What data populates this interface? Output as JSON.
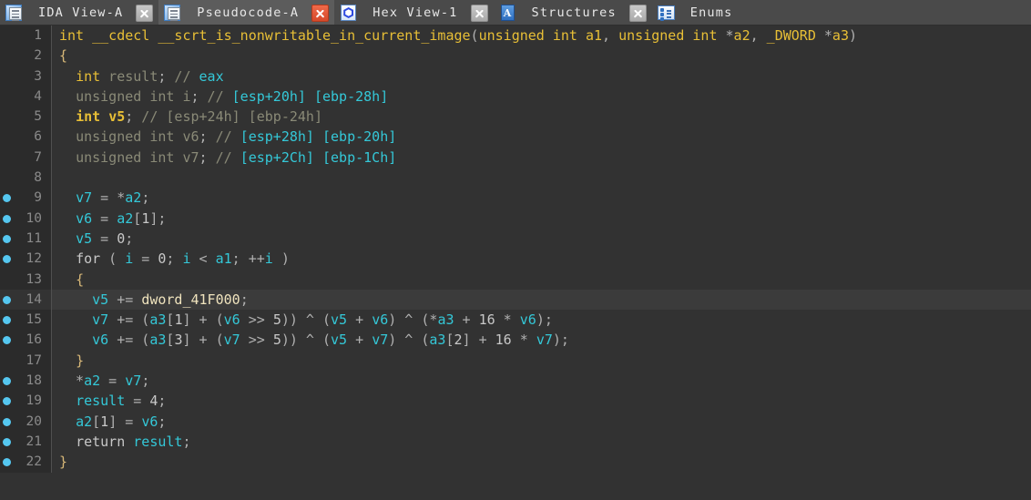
{
  "window": {
    "app": "IDA",
    "active_view": "Pseudocode-A"
  },
  "tabs": [
    {
      "label": "IDA View-A",
      "icon": "document-list-icon",
      "active": false,
      "closable": true,
      "close_style": "gray"
    },
    {
      "label": "Pseudocode-A",
      "icon": "document-list-icon",
      "active": true,
      "closable": true,
      "close_style": "red"
    },
    {
      "label": "Hex View-1",
      "icon": "hexagon-icon",
      "active": false,
      "closable": true,
      "close_style": "gray"
    },
    {
      "label": "Structures",
      "icon": "structures-a-icon",
      "active": false,
      "closable": true,
      "close_style": "gray"
    },
    {
      "label": "Enums",
      "icon": "enums-list-icon",
      "active": false,
      "closable": false,
      "close_style": "none"
    }
  ],
  "colors": {
    "tab_bar_bg": "#4a4a4a",
    "tab_active_bg": "#5c5c5c",
    "code_bg": "#323232",
    "gutter_bg": "#2b2b2b",
    "highlight_row_bg": "#3b3b3b",
    "breakpoint_dot": "#55c7f0",
    "keyword": "#e8bf36",
    "variable": "#34c8d8",
    "comment": "#8a8a77",
    "global_name": "#efe3bd",
    "line_number": "#8a8a8a",
    "punctuation": "#b0b0b0",
    "brace": "#d8b878"
  },
  "pseudocode": {
    "function_name": "__scrt_is_nonwritable_in_current_image",
    "highlighted_line": 14,
    "lines": [
      {
        "n": 1,
        "bp": false,
        "hl": false,
        "tokens": [
          {
            "t": "int",
            "c": "t-kw"
          },
          {
            "t": " ",
            "c": "t-pun"
          },
          {
            "t": "__cdecl",
            "c": "t-kw"
          },
          {
            "t": " ",
            "c": "t-pun"
          },
          {
            "t": "__scrt_is_nonwritable_in_current_image",
            "c": "t-fn"
          },
          {
            "t": "(",
            "c": "t-pun"
          },
          {
            "t": "unsigned int",
            "c": "t-kw"
          },
          {
            "t": " ",
            "c": "t-pun"
          },
          {
            "t": "a1",
            "c": "t-kw"
          },
          {
            "t": ", ",
            "c": "t-pun"
          },
          {
            "t": "unsigned int",
            "c": "t-kw"
          },
          {
            "t": " *",
            "c": "t-pun"
          },
          {
            "t": "a2",
            "c": "t-kw"
          },
          {
            "t": ", ",
            "c": "t-pun"
          },
          {
            "t": "_DWORD",
            "c": "t-kw"
          },
          {
            "t": " *",
            "c": "t-pun"
          },
          {
            "t": "a3",
            "c": "t-kw"
          },
          {
            "t": ")",
            "c": "t-pun"
          }
        ]
      },
      {
        "n": 2,
        "bp": false,
        "hl": false,
        "tokens": [
          {
            "t": "{",
            "c": "t-brc"
          }
        ]
      },
      {
        "n": 3,
        "bp": false,
        "hl": false,
        "tokens": [
          {
            "t": "  ",
            "c": "t-pun"
          },
          {
            "t": "int",
            "c": "t-kw"
          },
          {
            "t": " result",
            "c": "t-cmt"
          },
          {
            "t": ";",
            "c": "t-pun"
          },
          {
            "t": " // ",
            "c": "t-cmt"
          },
          {
            "t": "eax",
            "c": "t-cmtv"
          }
        ]
      },
      {
        "n": 4,
        "bp": false,
        "hl": false,
        "tokens": [
          {
            "t": "  ",
            "c": "t-pun"
          },
          {
            "t": "unsigned int",
            "c": "t-cmt"
          },
          {
            "t": " i",
            "c": "t-cmt"
          },
          {
            "t": ";",
            "c": "t-pun"
          },
          {
            "t": " // ",
            "c": "t-cmt"
          },
          {
            "t": "[esp+20h] [ebp-28h]",
            "c": "t-cmtv"
          }
        ]
      },
      {
        "n": 5,
        "bp": false,
        "hl": false,
        "tokens": [
          {
            "t": "  ",
            "c": "t-pun"
          },
          {
            "t": "int",
            "c": "t-hl"
          },
          {
            "t": " ",
            "c": "t-pun"
          },
          {
            "t": "v5",
            "c": "t-hl"
          },
          {
            "t": ";",
            "c": "t-pun"
          },
          {
            "t": " // ",
            "c": "t-cmt"
          },
          {
            "t": "[esp+24h] [ebp-24h]",
            "c": "t-cmt"
          }
        ]
      },
      {
        "n": 6,
        "bp": false,
        "hl": false,
        "tokens": [
          {
            "t": "  ",
            "c": "t-pun"
          },
          {
            "t": "unsigned int",
            "c": "t-cmt"
          },
          {
            "t": " v6",
            "c": "t-cmt"
          },
          {
            "t": ";",
            "c": "t-pun"
          },
          {
            "t": " // ",
            "c": "t-cmt"
          },
          {
            "t": "[esp+28h] [ebp-20h]",
            "c": "t-cmtv"
          }
        ]
      },
      {
        "n": 7,
        "bp": false,
        "hl": false,
        "tokens": [
          {
            "t": "  ",
            "c": "t-pun"
          },
          {
            "t": "unsigned int",
            "c": "t-cmt"
          },
          {
            "t": " v7",
            "c": "t-cmt"
          },
          {
            "t": ";",
            "c": "t-pun"
          },
          {
            "t": " // ",
            "c": "t-cmt"
          },
          {
            "t": "[esp+2Ch] [ebp-1Ch]",
            "c": "t-cmtv"
          }
        ]
      },
      {
        "n": 8,
        "bp": false,
        "hl": false,
        "tokens": []
      },
      {
        "n": 9,
        "bp": true,
        "hl": false,
        "tokens": [
          {
            "t": "  ",
            "c": "t-pun"
          },
          {
            "t": "v7",
            "c": "t-var"
          },
          {
            "t": " = *",
            "c": "t-pun"
          },
          {
            "t": "a2",
            "c": "t-var"
          },
          {
            "t": ";",
            "c": "t-pun"
          }
        ]
      },
      {
        "n": 10,
        "bp": true,
        "hl": false,
        "tokens": [
          {
            "t": "  ",
            "c": "t-pun"
          },
          {
            "t": "v6",
            "c": "t-var"
          },
          {
            "t": " = ",
            "c": "t-pun"
          },
          {
            "t": "a2",
            "c": "t-var"
          },
          {
            "t": "[",
            "c": "t-pun"
          },
          {
            "t": "1",
            "c": "t-num"
          },
          {
            "t": "];",
            "c": "t-pun"
          }
        ]
      },
      {
        "n": 11,
        "bp": true,
        "hl": false,
        "tokens": [
          {
            "t": "  ",
            "c": "t-pun"
          },
          {
            "t": "v5",
            "c": "t-var"
          },
          {
            "t": " = ",
            "c": "t-pun"
          },
          {
            "t": "0",
            "c": "t-num"
          },
          {
            "t": ";",
            "c": "t-pun"
          }
        ]
      },
      {
        "n": 12,
        "bp": true,
        "hl": false,
        "tokens": [
          {
            "t": "  ",
            "c": "t-pun"
          },
          {
            "t": "for",
            "c": "t-kw2"
          },
          {
            "t": " ( ",
            "c": "t-pun"
          },
          {
            "t": "i",
            "c": "t-var"
          },
          {
            "t": " = ",
            "c": "t-pun"
          },
          {
            "t": "0",
            "c": "t-num"
          },
          {
            "t": "; ",
            "c": "t-pun"
          },
          {
            "t": "i",
            "c": "t-var"
          },
          {
            "t": " < ",
            "c": "t-pun"
          },
          {
            "t": "a1",
            "c": "t-var"
          },
          {
            "t": "; ++",
            "c": "t-pun"
          },
          {
            "t": "i",
            "c": "t-var"
          },
          {
            "t": " )",
            "c": "t-pun"
          }
        ]
      },
      {
        "n": 13,
        "bp": false,
        "hl": false,
        "tokens": [
          {
            "t": "  ",
            "c": "t-pun"
          },
          {
            "t": "{",
            "c": "t-brc"
          }
        ]
      },
      {
        "n": 14,
        "bp": true,
        "hl": true,
        "tokens": [
          {
            "t": "    ",
            "c": "t-pun"
          },
          {
            "t": "v5",
            "c": "t-var"
          },
          {
            "t": " += ",
            "c": "t-pun"
          },
          {
            "t": "dword_41F000",
            "c": "t-glob"
          },
          {
            "t": ";",
            "c": "t-pun"
          }
        ]
      },
      {
        "n": 15,
        "bp": true,
        "hl": false,
        "tokens": [
          {
            "t": "    ",
            "c": "t-pun"
          },
          {
            "t": "v7",
            "c": "t-var"
          },
          {
            "t": " += (",
            "c": "t-pun"
          },
          {
            "t": "a3",
            "c": "t-var"
          },
          {
            "t": "[",
            "c": "t-pun"
          },
          {
            "t": "1",
            "c": "t-num"
          },
          {
            "t": "] + (",
            "c": "t-pun"
          },
          {
            "t": "v6",
            "c": "t-var"
          },
          {
            "t": " >> ",
            "c": "t-pun"
          },
          {
            "t": "5",
            "c": "t-num"
          },
          {
            "t": ")) ^ (",
            "c": "t-pun"
          },
          {
            "t": "v5",
            "c": "t-var"
          },
          {
            "t": " + ",
            "c": "t-pun"
          },
          {
            "t": "v6",
            "c": "t-var"
          },
          {
            "t": ") ^ (*",
            "c": "t-pun"
          },
          {
            "t": "a3",
            "c": "t-var"
          },
          {
            "t": " + ",
            "c": "t-pun"
          },
          {
            "t": "16",
            "c": "t-num"
          },
          {
            "t": " * ",
            "c": "t-pun"
          },
          {
            "t": "v6",
            "c": "t-var"
          },
          {
            "t": ");",
            "c": "t-pun"
          }
        ]
      },
      {
        "n": 16,
        "bp": true,
        "hl": false,
        "tokens": [
          {
            "t": "    ",
            "c": "t-pun"
          },
          {
            "t": "v6",
            "c": "t-var"
          },
          {
            "t": " += (",
            "c": "t-pun"
          },
          {
            "t": "a3",
            "c": "t-var"
          },
          {
            "t": "[",
            "c": "t-pun"
          },
          {
            "t": "3",
            "c": "t-num"
          },
          {
            "t": "] + (",
            "c": "t-pun"
          },
          {
            "t": "v7",
            "c": "t-var"
          },
          {
            "t": " >> ",
            "c": "t-pun"
          },
          {
            "t": "5",
            "c": "t-num"
          },
          {
            "t": ")) ^ (",
            "c": "t-pun"
          },
          {
            "t": "v5",
            "c": "t-var"
          },
          {
            "t": " + ",
            "c": "t-pun"
          },
          {
            "t": "v7",
            "c": "t-var"
          },
          {
            "t": ") ^ (",
            "c": "t-pun"
          },
          {
            "t": "a3",
            "c": "t-var"
          },
          {
            "t": "[",
            "c": "t-pun"
          },
          {
            "t": "2",
            "c": "t-num"
          },
          {
            "t": "] + ",
            "c": "t-pun"
          },
          {
            "t": "16",
            "c": "t-num"
          },
          {
            "t": " * ",
            "c": "t-pun"
          },
          {
            "t": "v7",
            "c": "t-var"
          },
          {
            "t": ");",
            "c": "t-pun"
          }
        ]
      },
      {
        "n": 17,
        "bp": false,
        "hl": false,
        "tokens": [
          {
            "t": "  ",
            "c": "t-pun"
          },
          {
            "t": "}",
            "c": "t-brc"
          }
        ]
      },
      {
        "n": 18,
        "bp": true,
        "hl": false,
        "tokens": [
          {
            "t": "  *",
            "c": "t-pun"
          },
          {
            "t": "a2",
            "c": "t-var"
          },
          {
            "t": " = ",
            "c": "t-pun"
          },
          {
            "t": "v7",
            "c": "t-var"
          },
          {
            "t": ";",
            "c": "t-pun"
          }
        ]
      },
      {
        "n": 19,
        "bp": true,
        "hl": false,
        "tokens": [
          {
            "t": "  ",
            "c": "t-pun"
          },
          {
            "t": "result",
            "c": "t-var"
          },
          {
            "t": " = ",
            "c": "t-pun"
          },
          {
            "t": "4",
            "c": "t-num"
          },
          {
            "t": ";",
            "c": "t-pun"
          }
        ]
      },
      {
        "n": 20,
        "bp": true,
        "hl": false,
        "tokens": [
          {
            "t": "  ",
            "c": "t-pun"
          },
          {
            "t": "a2",
            "c": "t-var"
          },
          {
            "t": "[",
            "c": "t-pun"
          },
          {
            "t": "1",
            "c": "t-num"
          },
          {
            "t": "] = ",
            "c": "t-pun"
          },
          {
            "t": "v6",
            "c": "t-var"
          },
          {
            "t": ";",
            "c": "t-pun"
          }
        ]
      },
      {
        "n": 21,
        "bp": true,
        "hl": false,
        "tokens": [
          {
            "t": "  ",
            "c": "t-pun"
          },
          {
            "t": "return",
            "c": "t-kw2"
          },
          {
            "t": " ",
            "c": "t-pun"
          },
          {
            "t": "result",
            "c": "t-var"
          },
          {
            "t": ";",
            "c": "t-pun"
          }
        ]
      },
      {
        "n": 22,
        "bp": true,
        "hl": false,
        "tokens": [
          {
            "t": "}",
            "c": "t-brc"
          }
        ]
      }
    ]
  }
}
